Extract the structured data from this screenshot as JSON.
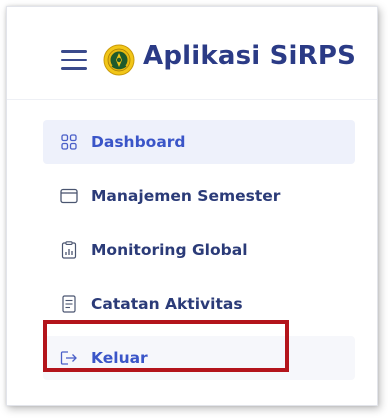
{
  "app": {
    "title": "Aplikasi SiRPS"
  },
  "icons": {
    "hamburger": "hamburger-menu-icon",
    "logo": "university-seal-logo"
  },
  "colors": {
    "brand": "#2b3b86",
    "active_text": "#3a55c8",
    "active_bg": "#eef1fb",
    "highlight": "#b3141b"
  },
  "sidebar": {
    "items": [
      {
        "label": "Dashboard",
        "icon": "grid-icon",
        "active": true
      },
      {
        "label": "Manajemen Semester",
        "icon": "window-icon",
        "active": false
      },
      {
        "label": "Monitoring Global",
        "icon": "report-chart-icon",
        "active": false
      },
      {
        "label": "Catatan Aktivitas",
        "icon": "document-list-icon",
        "active": false
      },
      {
        "label": "Keluar",
        "icon": "logout-arrow-icon",
        "active": false,
        "highlighted": true
      }
    ]
  }
}
